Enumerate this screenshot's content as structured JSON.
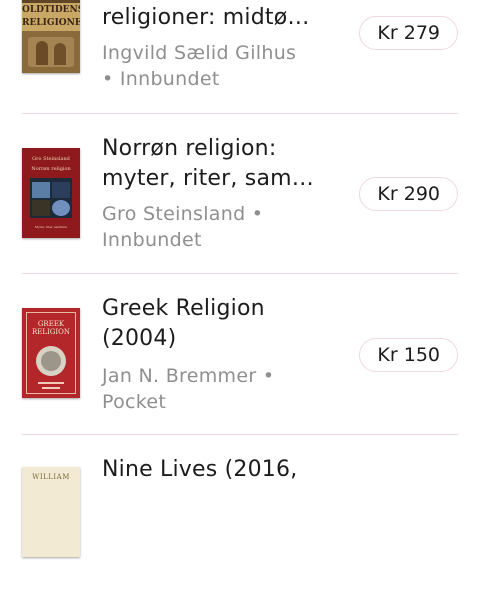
{
  "books": [
    {
      "title_lines": [
        "religioner: midtø…"
      ],
      "author": "Ingvild Sælid Gilhus",
      "separator": "•",
      "format": "Innbundet",
      "price": "Kr 279",
      "cover": {
        "title_line1": "OLDTIDENS",
        "title_line2": "RELIGIONER",
        "colors": {
          "base": "#8a6a3a",
          "band": "#c9a867",
          "text": "#f3e3b8"
        }
      }
    },
    {
      "title_lines": [
        "Norrøn religion:",
        "myter, riter, sam…"
      ],
      "author": "Gro Steinsland",
      "separator": "•",
      "format": "Innbundet",
      "price": "Kr 290",
      "cover": {
        "author": "Gro Steinsland",
        "title": "Norrøn religion",
        "subtitle": "Myter, riter, samfunn",
        "colors": {
          "base": "#8e1a1e",
          "text": "#f0d6b0"
        }
      }
    },
    {
      "title_lines": [
        "Greek Religion",
        "(2004)"
      ],
      "author": "Jan N. Bremmer",
      "separator": "•",
      "format": "Pocket",
      "price": "Kr 150",
      "cover": {
        "title_line1": "GREEK",
        "title_line2": "RELIGION",
        "colors": {
          "base": "#b3262a",
          "text": "#f6e6cf"
        }
      }
    },
    {
      "title_lines": [
        "Nine Lives (2016,"
      ],
      "cover": {
        "author": "WILLIAM",
        "colors": {
          "base": "#f2ead2",
          "text": "#7a6a40"
        }
      }
    }
  ],
  "colors": {
    "divider": "#f1d9de",
    "price_border": "#efd8de",
    "title_text": "#1c1c1c",
    "meta_text": "#8f8f8f"
  }
}
